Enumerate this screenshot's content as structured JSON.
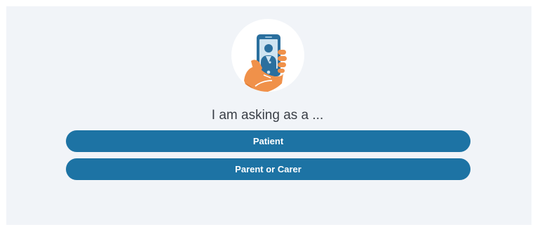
{
  "question": "I am asking as a ...",
  "choices": [
    {
      "label": "Patient"
    },
    {
      "label": "Parent or Carer"
    }
  ],
  "icons": {
    "header_illustration": "hand-holding-phone-video-call-icon"
  },
  "colors": {
    "button_bg": "#1d73a4",
    "button_text": "#ffffff",
    "panel_bg": "#f1f4f8",
    "hand": "#f0914a",
    "phone": "#2a6f9e"
  }
}
